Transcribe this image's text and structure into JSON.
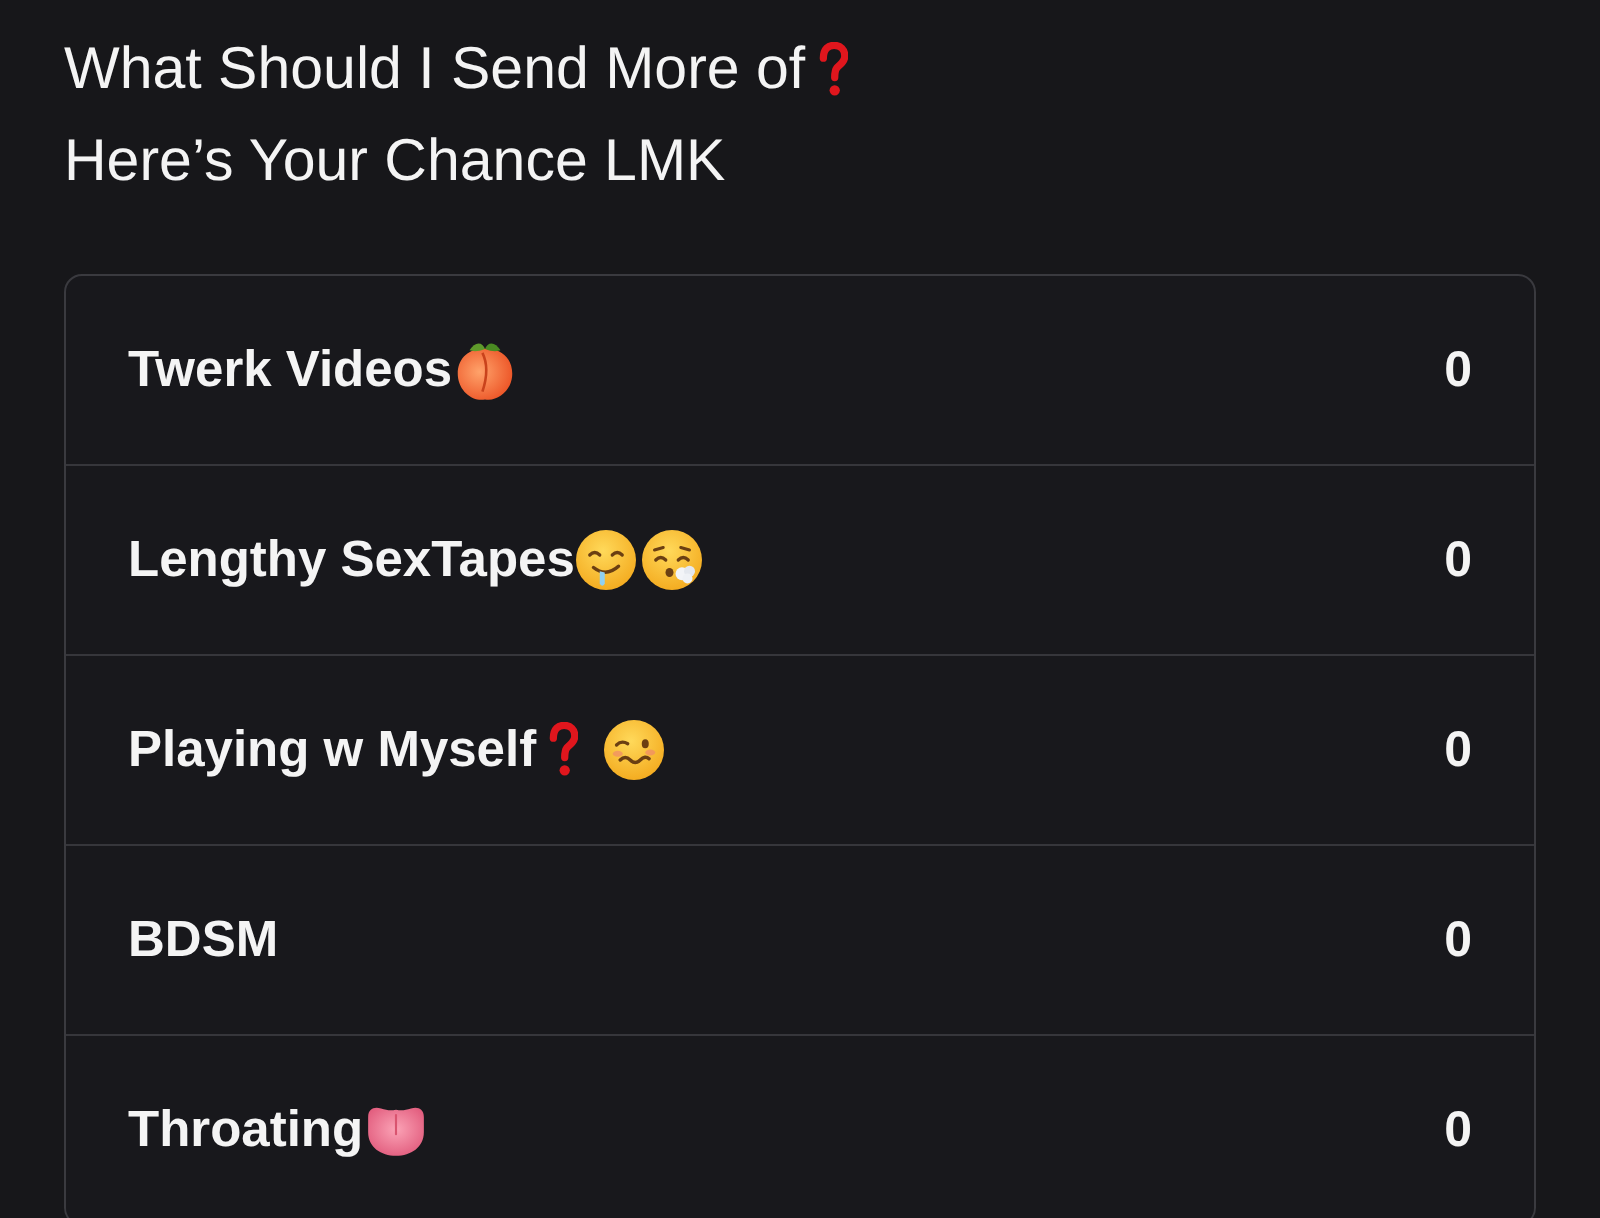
{
  "post": {
    "text_lines": [
      {
        "text": "What Should I Send More of",
        "emojis": [
          {
            "kind": "question"
          }
        ]
      },
      {
        "text": "Here’s Your Chance LMK"
      }
    ]
  },
  "poll": {
    "options": [
      {
        "label": "Twerk Videos",
        "emojis": [
          {
            "kind": "peach"
          }
        ],
        "votes": "0"
      },
      {
        "label": "Lengthy SexTapes",
        "emojis": [
          {
            "kind": "drooling"
          },
          {
            "kind": "exhaling"
          }
        ],
        "votes": "0"
      },
      {
        "label": "Playing w Myself",
        "emojis": [
          {
            "kind": "question"
          },
          {
            "kind": "woozy"
          }
        ],
        "votes": "0"
      },
      {
        "label": "BDSM",
        "votes": "0"
      },
      {
        "label": "Throating",
        "emojis": [
          {
            "kind": "tongue"
          }
        ],
        "votes": "0"
      }
    ]
  }
}
